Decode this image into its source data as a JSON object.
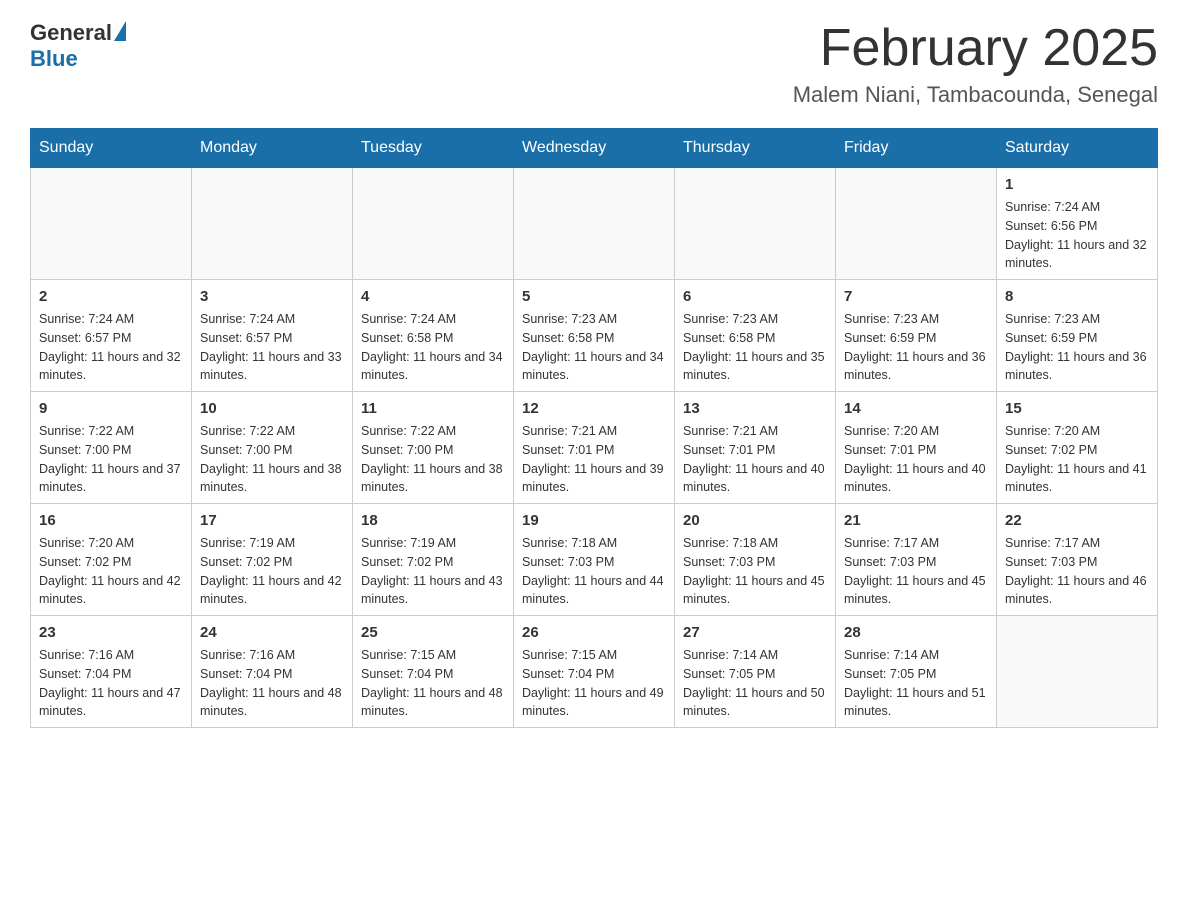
{
  "header": {
    "logo_general": "General",
    "logo_blue": "Blue",
    "month_title": "February 2025",
    "location": "Malem Niani, Tambacounda, Senegal"
  },
  "weekdays": [
    "Sunday",
    "Monday",
    "Tuesday",
    "Wednesday",
    "Thursday",
    "Friday",
    "Saturday"
  ],
  "weeks": [
    [
      {
        "day": "",
        "info": ""
      },
      {
        "day": "",
        "info": ""
      },
      {
        "day": "",
        "info": ""
      },
      {
        "day": "",
        "info": ""
      },
      {
        "day": "",
        "info": ""
      },
      {
        "day": "",
        "info": ""
      },
      {
        "day": "1",
        "info": "Sunrise: 7:24 AM\nSunset: 6:56 PM\nDaylight: 11 hours and 32 minutes."
      }
    ],
    [
      {
        "day": "2",
        "info": "Sunrise: 7:24 AM\nSunset: 6:57 PM\nDaylight: 11 hours and 32 minutes."
      },
      {
        "day": "3",
        "info": "Sunrise: 7:24 AM\nSunset: 6:57 PM\nDaylight: 11 hours and 33 minutes."
      },
      {
        "day": "4",
        "info": "Sunrise: 7:24 AM\nSunset: 6:58 PM\nDaylight: 11 hours and 34 minutes."
      },
      {
        "day": "5",
        "info": "Sunrise: 7:23 AM\nSunset: 6:58 PM\nDaylight: 11 hours and 34 minutes."
      },
      {
        "day": "6",
        "info": "Sunrise: 7:23 AM\nSunset: 6:58 PM\nDaylight: 11 hours and 35 minutes."
      },
      {
        "day": "7",
        "info": "Sunrise: 7:23 AM\nSunset: 6:59 PM\nDaylight: 11 hours and 36 minutes."
      },
      {
        "day": "8",
        "info": "Sunrise: 7:23 AM\nSunset: 6:59 PM\nDaylight: 11 hours and 36 minutes."
      }
    ],
    [
      {
        "day": "9",
        "info": "Sunrise: 7:22 AM\nSunset: 7:00 PM\nDaylight: 11 hours and 37 minutes."
      },
      {
        "day": "10",
        "info": "Sunrise: 7:22 AM\nSunset: 7:00 PM\nDaylight: 11 hours and 38 minutes."
      },
      {
        "day": "11",
        "info": "Sunrise: 7:22 AM\nSunset: 7:00 PM\nDaylight: 11 hours and 38 minutes."
      },
      {
        "day": "12",
        "info": "Sunrise: 7:21 AM\nSunset: 7:01 PM\nDaylight: 11 hours and 39 minutes."
      },
      {
        "day": "13",
        "info": "Sunrise: 7:21 AM\nSunset: 7:01 PM\nDaylight: 11 hours and 40 minutes."
      },
      {
        "day": "14",
        "info": "Sunrise: 7:20 AM\nSunset: 7:01 PM\nDaylight: 11 hours and 40 minutes."
      },
      {
        "day": "15",
        "info": "Sunrise: 7:20 AM\nSunset: 7:02 PM\nDaylight: 11 hours and 41 minutes."
      }
    ],
    [
      {
        "day": "16",
        "info": "Sunrise: 7:20 AM\nSunset: 7:02 PM\nDaylight: 11 hours and 42 minutes."
      },
      {
        "day": "17",
        "info": "Sunrise: 7:19 AM\nSunset: 7:02 PM\nDaylight: 11 hours and 42 minutes."
      },
      {
        "day": "18",
        "info": "Sunrise: 7:19 AM\nSunset: 7:02 PM\nDaylight: 11 hours and 43 minutes."
      },
      {
        "day": "19",
        "info": "Sunrise: 7:18 AM\nSunset: 7:03 PM\nDaylight: 11 hours and 44 minutes."
      },
      {
        "day": "20",
        "info": "Sunrise: 7:18 AM\nSunset: 7:03 PM\nDaylight: 11 hours and 45 minutes."
      },
      {
        "day": "21",
        "info": "Sunrise: 7:17 AM\nSunset: 7:03 PM\nDaylight: 11 hours and 45 minutes."
      },
      {
        "day": "22",
        "info": "Sunrise: 7:17 AM\nSunset: 7:03 PM\nDaylight: 11 hours and 46 minutes."
      }
    ],
    [
      {
        "day": "23",
        "info": "Sunrise: 7:16 AM\nSunset: 7:04 PM\nDaylight: 11 hours and 47 minutes."
      },
      {
        "day": "24",
        "info": "Sunrise: 7:16 AM\nSunset: 7:04 PM\nDaylight: 11 hours and 48 minutes."
      },
      {
        "day": "25",
        "info": "Sunrise: 7:15 AM\nSunset: 7:04 PM\nDaylight: 11 hours and 48 minutes."
      },
      {
        "day": "26",
        "info": "Sunrise: 7:15 AM\nSunset: 7:04 PM\nDaylight: 11 hours and 49 minutes."
      },
      {
        "day": "27",
        "info": "Sunrise: 7:14 AM\nSunset: 7:05 PM\nDaylight: 11 hours and 50 minutes."
      },
      {
        "day": "28",
        "info": "Sunrise: 7:14 AM\nSunset: 7:05 PM\nDaylight: 11 hours and 51 minutes."
      },
      {
        "day": "",
        "info": ""
      }
    ]
  ]
}
